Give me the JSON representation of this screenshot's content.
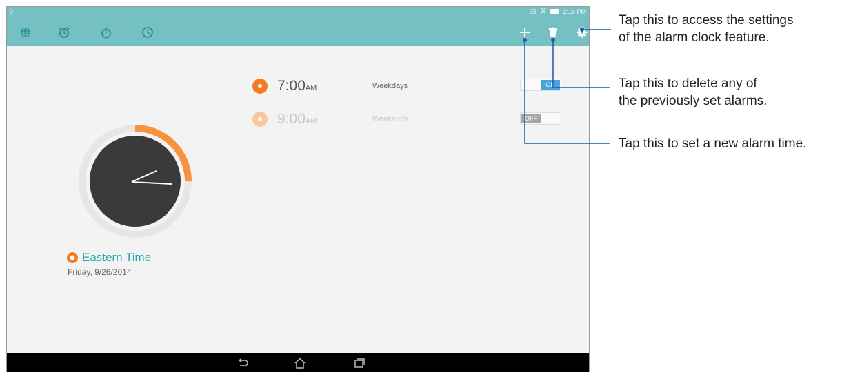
{
  "status_bar": {
    "left_indicator": "0",
    "time": "2:16 PM"
  },
  "toolbar": {
    "tabs": [
      {
        "icon": "globe-icon"
      },
      {
        "icon": "alarm-clock-icon"
      },
      {
        "icon": "stopwatch-icon"
      },
      {
        "icon": "timer-icon"
      }
    ],
    "actions": [
      {
        "icon": "plus-icon"
      },
      {
        "icon": "trash-icon"
      },
      {
        "icon": "gear-icon"
      }
    ]
  },
  "alarms": [
    {
      "time": "7:00",
      "ampm": "AM",
      "repeat": "Weekdays",
      "enabled": true,
      "toggle_label": "ON"
    },
    {
      "time": "9:00",
      "ampm": "AM",
      "repeat": "Weekends",
      "enabled": false,
      "toggle_label": "OFF"
    }
  ],
  "world_clock": {
    "timezone": "Eastern Time",
    "date": "Friday, 9/26/2014"
  },
  "nav_bar": {
    "buttons": [
      "back-icon",
      "home-icon",
      "recent-apps-icon"
    ]
  },
  "callouts": {
    "settings": {
      "line1": "Tap this to access the settings",
      "line2": "of the alarm clock feature."
    },
    "delete": {
      "line1": "Tap this to delete any of",
      "line2": "the previously set alarms."
    },
    "add": {
      "line1": "Tap this to set a new alarm time."
    }
  },
  "colors": {
    "toolbar": "#75c0c2",
    "accent": "#f47a20",
    "toggle_on": "#4aa3dc",
    "callout_line": "#1b5aa6"
  }
}
